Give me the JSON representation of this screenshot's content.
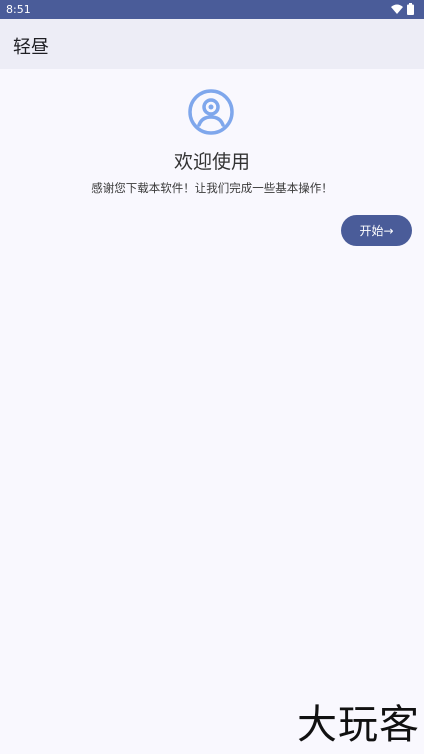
{
  "status_bar": {
    "time": "8:51",
    "icons": [
      "wifi-icon",
      "battery-icon"
    ]
  },
  "app_bar": {
    "title": "轻昼"
  },
  "welcome": {
    "avatar_icon": "account-circle-icon",
    "title": "欢迎使用",
    "subtitle": "感谢您下载本软件！让我们完成一些基本操作！",
    "start_button_label": "开始→"
  },
  "watermark": {
    "text": "大玩客"
  },
  "colors": {
    "primary": "#4a5c99",
    "app_bar_bg": "#ededf6",
    "page_bg": "#f9f8fe",
    "avatar_blue": "#7fa7ec"
  }
}
